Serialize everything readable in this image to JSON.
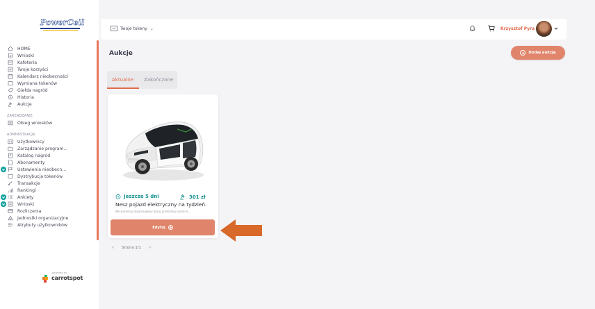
{
  "app": {
    "logo_text": "PowerCell"
  },
  "sidebar": {
    "items": [
      {
        "label": "HOME",
        "icon": "home-icon"
      },
      {
        "label": "Wnioski",
        "icon": "document-icon"
      },
      {
        "label": "Kafeteria",
        "icon": "grid-icon"
      },
      {
        "label": "Twoje korzyści",
        "icon": "benefits-icon"
      },
      {
        "label": "Kalendarz nieobecności",
        "icon": "calendar-icon"
      },
      {
        "label": "Wymiana tokenów",
        "icon": "exchange-icon"
      },
      {
        "label": "Giełda nagród",
        "icon": "tag-icon"
      },
      {
        "label": "Historia",
        "icon": "history-icon"
      },
      {
        "label": "Aukcje",
        "icon": "hammer-icon"
      }
    ],
    "section_management": "ZARZĄDZANIE",
    "management_items": [
      {
        "label": "Obieg wniosków",
        "icon": "workflow-icon"
      }
    ],
    "section_admin": "ADMINISTRACJA",
    "admin_items": [
      {
        "label": "Użytkownicy",
        "icon": "users-icon"
      },
      {
        "label": "Zarządzanie program...",
        "icon": "folder-icon"
      },
      {
        "label": "Katalog nagród",
        "icon": "catalog-icon"
      },
      {
        "label": "Abonamenty",
        "icon": "subscription-icon"
      },
      {
        "label": "Ustawienia nieobecn...",
        "icon": "flag-icon"
      },
      {
        "label": "Dystrybucja tokenów",
        "icon": "distribution-icon"
      },
      {
        "label": "Transakcje",
        "icon": "transactions-icon"
      },
      {
        "label": "Rankingi",
        "icon": "bar-chart-icon"
      },
      {
        "label": "Ankiety",
        "icon": "list-icon"
      },
      {
        "label": "Wnioski",
        "icon": "document-icon"
      },
      {
        "label": "Rozliczenia",
        "icon": "card-icon"
      },
      {
        "label": "Jednostki organizacyjne",
        "icon": "org-icon"
      },
      {
        "label": "Atrybuty użytkowników",
        "icon": "attributes-icon"
      }
    ],
    "powered_by": "powered by",
    "brand": "carrotspot"
  },
  "header": {
    "tokens_label": "Twoje tokeny",
    "user_name": "Krzysztof Pyra"
  },
  "page": {
    "title": "Aukcje",
    "add_button": "Dodaj aukcję",
    "tabs": [
      {
        "label": "Aktualne",
        "active": true
      },
      {
        "label": "Zakończone",
        "active": false
      }
    ]
  },
  "card": {
    "time_left": "Jeszcze 5 dni",
    "price": "301 zł",
    "title": "Nesz pojazd elektryczny na tydzień.",
    "description": "We wrześniu organizujemy akcję przetestuj nasze el...",
    "edit_button": "Edytuj"
  },
  "pagination": {
    "prev": "<",
    "label": "Strona 1/1",
    "next": ">"
  },
  "colors": {
    "accent": "#e0856b",
    "accent_text": "#e0694a",
    "teal": "#16928f",
    "arrow": "#d9682b"
  }
}
